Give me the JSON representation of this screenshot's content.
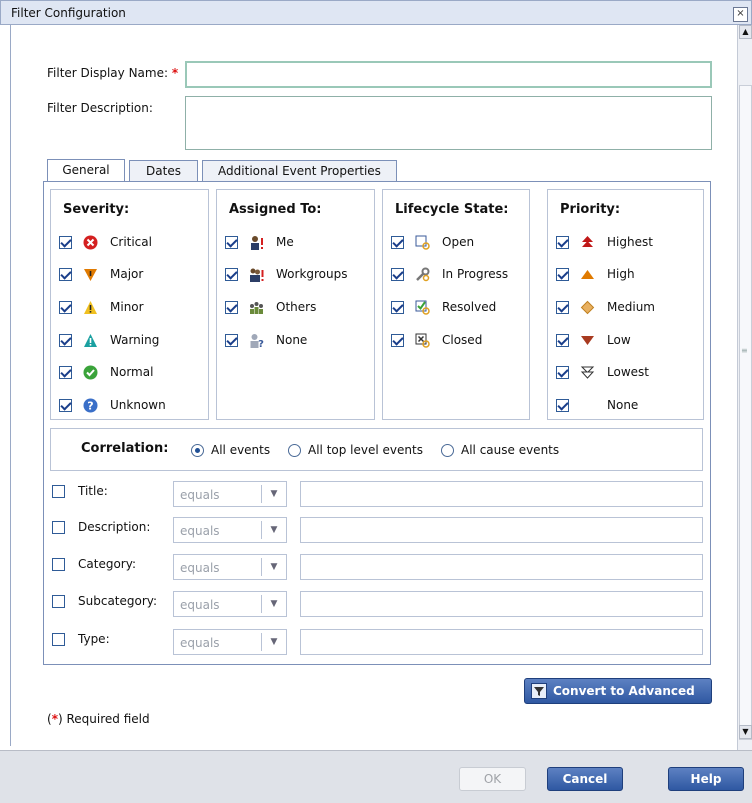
{
  "window": {
    "title": "Filter Configuration",
    "close_glyph": "×"
  },
  "form": {
    "display_name_label": "Filter Display Name:",
    "required_marker": "*",
    "display_name_value": "",
    "description_label": "Filter Description:",
    "description_value": ""
  },
  "tabs": [
    {
      "label": "General",
      "active": true
    },
    {
      "label": "Dates",
      "active": false
    },
    {
      "label": "Additional Event Properties",
      "active": false
    }
  ],
  "severity": {
    "heading": "Severity:",
    "items": [
      {
        "label": "Critical",
        "checked": true,
        "icon": "critical-icon"
      },
      {
        "label": "Major",
        "checked": true,
        "icon": "major-icon"
      },
      {
        "label": "Minor",
        "checked": true,
        "icon": "minor-icon"
      },
      {
        "label": "Warning",
        "checked": true,
        "icon": "warning-icon"
      },
      {
        "label": "Normal",
        "checked": true,
        "icon": "normal-icon"
      },
      {
        "label": "Unknown",
        "checked": true,
        "icon": "unknown-icon"
      }
    ]
  },
  "assigned": {
    "heading": "Assigned To:",
    "items": [
      {
        "label": "Me",
        "checked": true,
        "icon": "user-me-icon"
      },
      {
        "label": "Workgroups",
        "checked": true,
        "icon": "workgroups-icon"
      },
      {
        "label": "Others",
        "checked": true,
        "icon": "others-icon"
      },
      {
        "label": "None",
        "checked": true,
        "icon": "unassigned-icon"
      }
    ]
  },
  "lifecycle": {
    "heading": "Lifecycle State:",
    "items": [
      {
        "label": "Open",
        "checked": true,
        "icon": "open-icon"
      },
      {
        "label": "In Progress",
        "checked": true,
        "icon": "in-progress-icon"
      },
      {
        "label": "Resolved",
        "checked": true,
        "icon": "resolved-icon"
      },
      {
        "label": "Closed",
        "checked": true,
        "icon": "closed-icon"
      }
    ]
  },
  "priority": {
    "heading": "Priority:",
    "items": [
      {
        "label": "Highest",
        "checked": true,
        "icon": "highest-icon"
      },
      {
        "label": "High",
        "checked": true,
        "icon": "high-icon"
      },
      {
        "label": "Medium",
        "checked": true,
        "icon": "medium-icon"
      },
      {
        "label": "Low",
        "checked": true,
        "icon": "low-icon"
      },
      {
        "label": "Lowest",
        "checked": true,
        "icon": "lowest-icon"
      },
      {
        "label": "None",
        "checked": true,
        "icon": ""
      }
    ]
  },
  "correlation": {
    "label": "Correlation:",
    "options": [
      {
        "label": "All events",
        "selected": true
      },
      {
        "label": "All top level events",
        "selected": false
      },
      {
        "label": "All cause events",
        "selected": false
      }
    ]
  },
  "criteria": [
    {
      "label": "Title:",
      "operator": "equals",
      "value": ""
    },
    {
      "label": "Description:",
      "operator": "equals",
      "value": ""
    },
    {
      "label": "Category:",
      "operator": "equals",
      "value": ""
    },
    {
      "label": "Subcategory:",
      "operator": "equals",
      "value": ""
    },
    {
      "label": "Type:",
      "operator": "equals",
      "value": ""
    }
  ],
  "convert_button": "Convert to Advanced",
  "required_note": {
    "open": "(",
    "marker": "*",
    "close": ") Required field"
  },
  "footer": {
    "ok_label": "OK",
    "cancel_label": "Cancel",
    "help_label": "Help"
  },
  "colors": {
    "accent_blue": "#2f58a2",
    "required_red": "#d11111",
    "critical_red": "#d42020",
    "major_orange": "#e07a00",
    "warning_teal": "#1aa0a0",
    "normal_green": "#3aa33a",
    "unknown_blue": "#3a6fc8"
  }
}
